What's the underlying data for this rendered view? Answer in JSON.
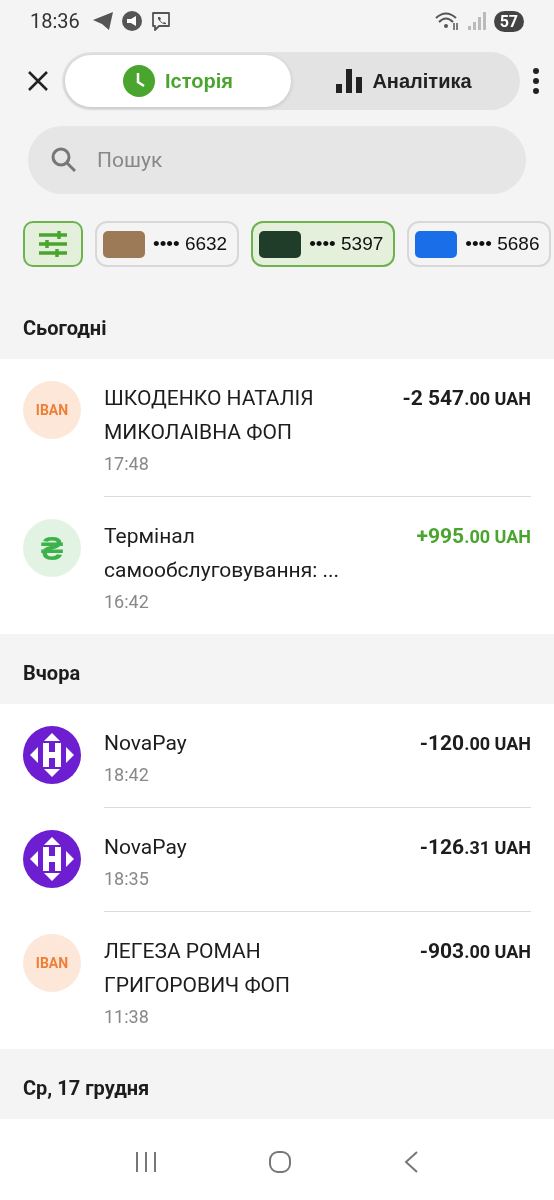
{
  "status_bar": {
    "time": "18:36",
    "battery": "57"
  },
  "tabs": [
    {
      "label": "Історія",
      "kind": "history",
      "selected": true
    },
    {
      "label": "Аналітика",
      "kind": "analytics",
      "selected": false
    }
  ],
  "search": {
    "placeholder": "Пошук"
  },
  "cards": [
    {
      "number": "•••• 6632",
      "color": "#9c7a58",
      "selected": false
    },
    {
      "number": "•••• 5397",
      "color": "#1f3d28",
      "selected": true
    },
    {
      "number": "•••• 5686",
      "color": "#1a6ee8",
      "selected": false
    }
  ],
  "sections": [
    {
      "title": "Сьогодні",
      "rows": [
        {
          "kind": "iban",
          "avatar_text": "IBAN",
          "title": "ШКОДЕНКО НАТАЛІЯ МИКОЛАІВНА ФОП",
          "time": "17:48",
          "amount_whole": "-2 547",
          "amount_cents": ".00 UAH",
          "income": false
        },
        {
          "kind": "hryvnia",
          "avatar_text": "₴",
          "title": "Термінал самообслуговування: ...",
          "time": "16:42",
          "amount_whole": "+995",
          "amount_cents": ".00 UAH",
          "income": true
        }
      ]
    },
    {
      "title": "Вчора",
      "rows": [
        {
          "kind": "novapay",
          "title": "NovaPay",
          "time": "18:42",
          "amount_whole": "-120",
          "amount_cents": ".00 UAH",
          "income": false
        },
        {
          "kind": "novapay",
          "title": "NovaPay",
          "time": "18:35",
          "amount_whole": "-126",
          "amount_cents": ".31 UAH",
          "income": false
        },
        {
          "kind": "iban",
          "avatar_text": "IBAN",
          "title": "ЛЕГЕЗА РОМАН ГРИГОРОВИЧ ФОП",
          "time": "11:38",
          "amount_whole": "-903",
          "amount_cents": ".00 UAH",
          "income": false
        }
      ]
    },
    {
      "title": "Ср, 17 грудня"
    }
  ]
}
